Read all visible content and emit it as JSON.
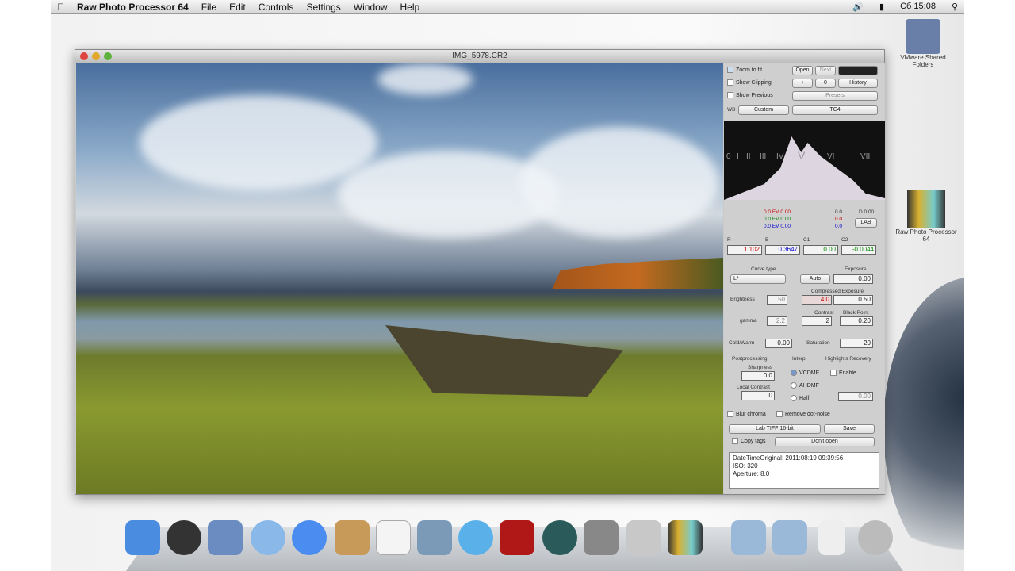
{
  "menubar": {
    "app": "Raw Photo Processor 64",
    "items": [
      "File",
      "Edit",
      "Controls",
      "Settings",
      "Window",
      "Help"
    ],
    "clock": "Сб 15:08"
  },
  "window": {
    "title": "IMG_5978.CR2"
  },
  "panel": {
    "zoom_to_fit": "Zoom to fit",
    "show_clipping": "Show Clipping",
    "show_previous": "Show Previous",
    "open": "Open",
    "next": "Next",
    "plus": "+",
    "zero": "0",
    "history": "History",
    "presets": "Presets",
    "wb": "WB",
    "wb_value": "Custom",
    "profile": "TC4",
    "zones": [
      "0",
      "I",
      "II",
      "III",
      "IV",
      "V",
      "VI",
      "VII"
    ],
    "ev_r": "0.0 EV 0.00",
    "ev_g": "0.0 EV 0.00",
    "ev_b": "0.0 EV 0.00",
    "L": "0.0",
    "a": "0.0",
    "b": "0.0",
    "D": "D 0.00",
    "lab_btn": "LAB",
    "rb_labels": [
      "R",
      "B",
      "C1",
      "C2"
    ],
    "rb_values": [
      "1.102",
      "0.3647",
      "0.00",
      "-0.0044"
    ],
    "curve_type": "Curve type",
    "curve_value": "L*",
    "exposure": "Exposure",
    "auto": "Auto",
    "exposure_value": "0.00",
    "brightness": "Brightness",
    "brightness_value": "50",
    "compressed_exposure": "Compressed Exposure",
    "ce_left": "4.0",
    "ce_value": "0.50",
    "gamma": "gamma",
    "gamma_value": "2.2",
    "contrast": "Contrast",
    "contrast_value": "2",
    "black_point": "Black Point",
    "black_point_value": "0.20",
    "cold_warm": "Cold/Warm",
    "cold_warm_value": "0.00",
    "saturation": "Saturation",
    "saturation_value": "20",
    "postprocessing": "Postprocessing",
    "interp": "Interp.",
    "highlights_recovery": "Highlights Recovery",
    "sharpness": "Sharpness",
    "sharpness_value": "0.0",
    "local_contrast": "Local Contrast",
    "local_contrast_value": "0",
    "vcdmf": "VCDMF",
    "ahdmf": "AHDMF",
    "half": "Half",
    "enable": "Enable",
    "hr_value": "0.00",
    "blur_chroma": "Blur chroma",
    "remove_dot_noise": "Remove dot-noise",
    "format": "Lab TIFF 16-bit",
    "save": "Save",
    "copy_tags": "Copy tags",
    "dont_open": "Don't open",
    "info": [
      "DateTimeOriginal: 2011:08:19 09:39:56",
      "ISO: 320",
      "Aperture: 8.0"
    ]
  },
  "desktop": {
    "shared": "VMware Shared Folders",
    "rpp": "Raw Photo Processor 64"
  }
}
